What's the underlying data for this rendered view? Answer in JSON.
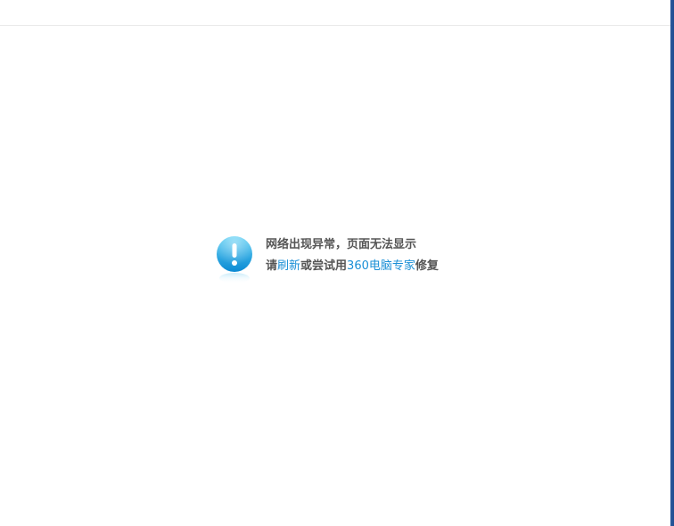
{
  "error": {
    "icon": "exclamation-circle-icon",
    "title": "网络出现异常，页面无法显示",
    "prefix": "请",
    "refresh_link": "刷新",
    "middle": "或尝试用",
    "repair_link": "360电脑专家",
    "suffix": "修复"
  },
  "colors": {
    "link": "#1a8fd6",
    "text": "#555555",
    "icon_top": "#4fc6f2",
    "icon_bottom": "#0e8fd6",
    "window_edge": "#1e4d91"
  }
}
